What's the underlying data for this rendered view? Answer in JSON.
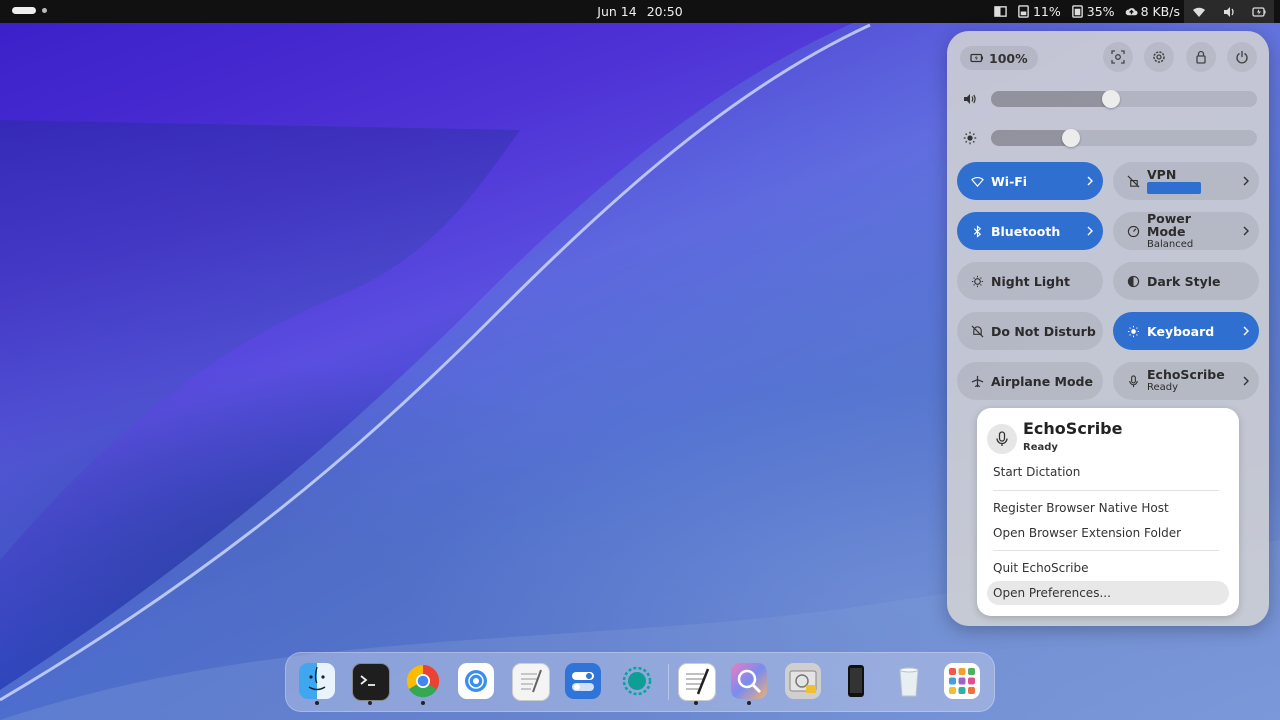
{
  "topbar": {
    "date": "Jun 14",
    "time": "20:50",
    "indicators": [
      {
        "icon": "memory-icon",
        "value": "11%"
      },
      {
        "icon": "cpu-icon",
        "value": "35%"
      },
      {
        "icon": "cloud-upload-icon",
        "value": "8 KB/s"
      }
    ],
    "tray_icons": [
      "wifi-icon",
      "volume-icon",
      "battery-icon"
    ]
  },
  "quick_settings": {
    "battery": "100%",
    "volume_level": 0.45,
    "brightness_level": 0.3,
    "tiles": [
      {
        "key": "wifi",
        "label": "Wi-Fi",
        "sub": "",
        "on": true,
        "chevron": true,
        "icon": "wifi-icon"
      },
      {
        "key": "vpn",
        "label": "VPN",
        "sub": "",
        "on": false,
        "chevron": true,
        "icon": "vpn-off-icon"
      },
      {
        "key": "bluetooth",
        "label": "Bluetooth",
        "sub": "",
        "on": true,
        "chevron": true,
        "icon": "bluetooth-icon"
      },
      {
        "key": "power",
        "label": "Power Mode",
        "sub": "Balanced",
        "on": false,
        "chevron": true,
        "icon": "power-mode-icon"
      },
      {
        "key": "night-light",
        "label": "Night Light",
        "sub": "",
        "on": false,
        "chevron": false,
        "icon": "night-light-icon"
      },
      {
        "key": "dark-style",
        "label": "Dark Style",
        "sub": "",
        "on": false,
        "chevron": false,
        "icon": "dark-style-icon"
      },
      {
        "key": "dnd",
        "label": "Do Not Disturb",
        "sub": "",
        "on": false,
        "chevron": false,
        "icon": "dnd-icon"
      },
      {
        "key": "keyboard",
        "label": "Keyboard",
        "sub": "",
        "on": true,
        "chevron": true,
        "icon": "keyboard-icon"
      },
      {
        "key": "airplane",
        "label": "Airplane Mode",
        "sub": "",
        "on": false,
        "chevron": false,
        "icon": "airplane-icon"
      },
      {
        "key": "echoscribe",
        "label": "EchoScribe",
        "sub": "Ready",
        "on": false,
        "chevron": true,
        "icon": "microphone-icon"
      }
    ]
  },
  "menu": {
    "title": "EchoScribe",
    "status": "Ready",
    "items": {
      "start": "Start Dictation",
      "register": "Register Browser Native Host",
      "open_ext": "Open Browser Extension Folder",
      "quit": "Quit EchoScribe",
      "prefs": "Open Preferences..."
    }
  },
  "dock": {
    "apps": [
      {
        "name": "finder-app",
        "icon": "finder-icon",
        "running": true
      },
      {
        "name": "terminal-app",
        "icon": "terminal-icon",
        "running": true
      },
      {
        "name": "chrome-app",
        "icon": "chrome-icon",
        "running": true
      },
      {
        "name": "browser-app",
        "icon": "safari-icon",
        "running": false
      },
      {
        "name": "text-editor-app",
        "icon": "text-editor-icon",
        "running": false
      },
      {
        "name": "settings-app",
        "icon": "toggles-icon",
        "running": false
      },
      {
        "name": "echoscribe-app",
        "icon": "spinner-icon",
        "running": false
      },
      {
        "name": "notes-app",
        "icon": "pen-paper-icon",
        "running": true
      },
      {
        "name": "image-viewer-app",
        "icon": "image-viewer-icon",
        "running": true
      },
      {
        "name": "disk-utility-app",
        "icon": "disk-icon",
        "running": false
      },
      {
        "name": "phone-app",
        "icon": "phone-icon",
        "running": false
      },
      {
        "name": "trash",
        "icon": "trash-icon",
        "running": false
      },
      {
        "name": "app-grid",
        "icon": "app-grid-icon",
        "running": false
      }
    ]
  }
}
